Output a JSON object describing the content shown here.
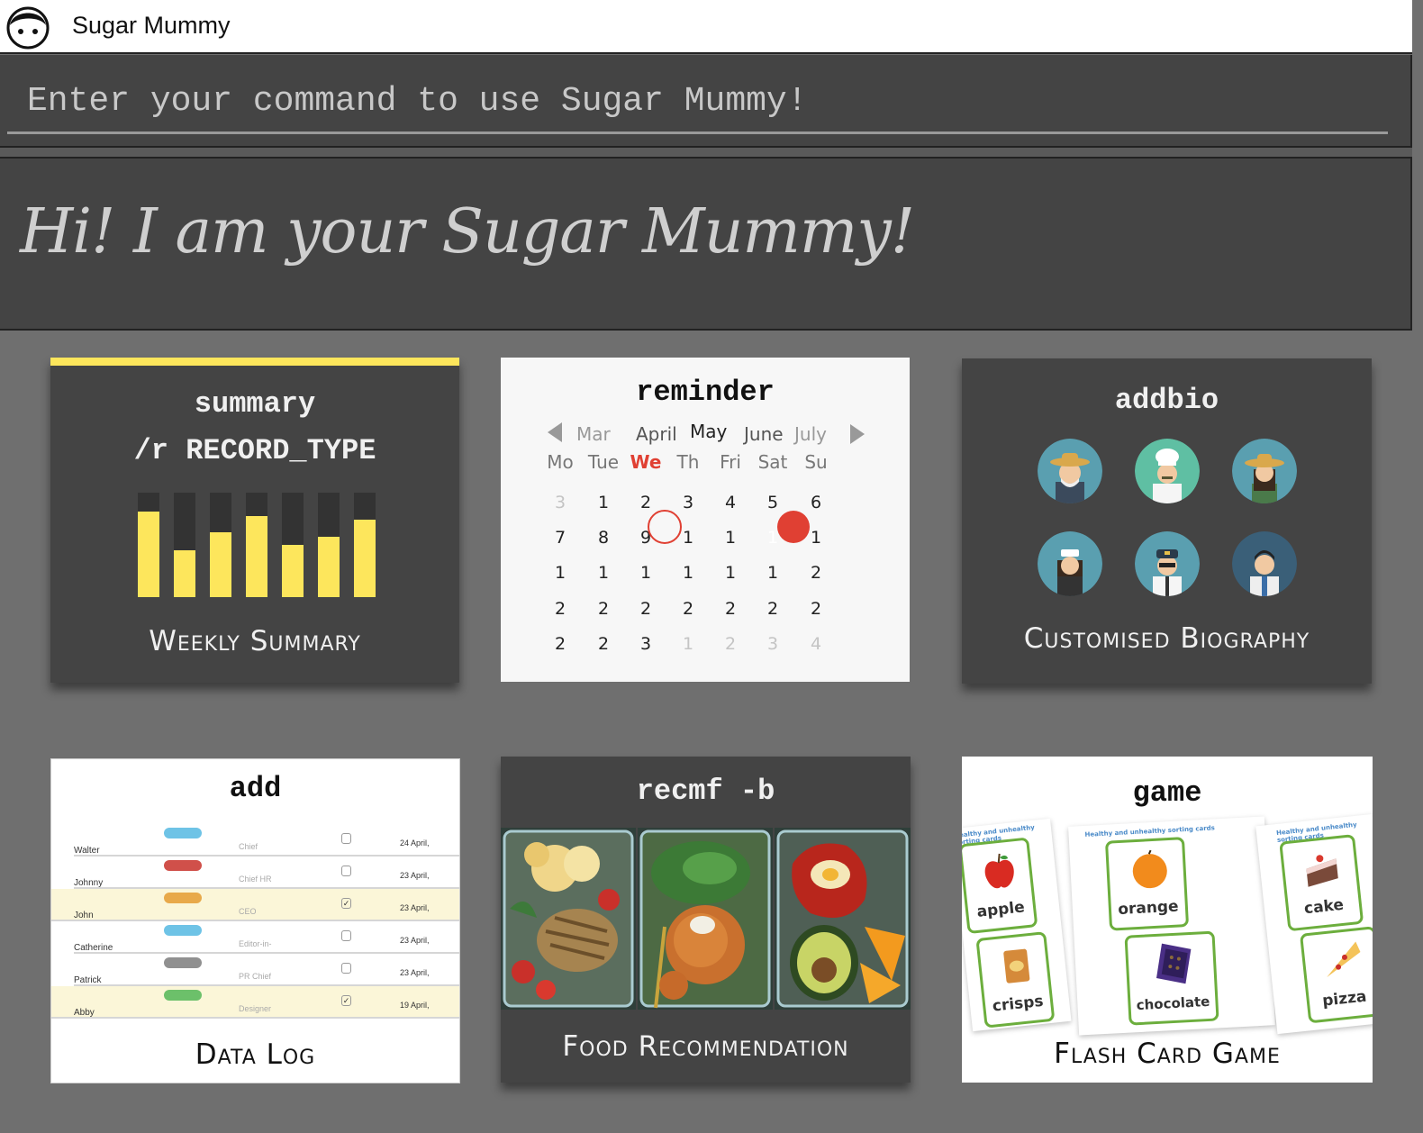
{
  "app": {
    "title": "Sugar Mummy"
  },
  "command": {
    "placeholder": "Enter your command to use Sugar Mummy!"
  },
  "welcome": {
    "greeting": "Hi! I am your Sugar Mummy!"
  },
  "colors": {
    "accent": "#fde65c",
    "panel": "#444444",
    "background": "#6f6f6f",
    "today": "#e04033"
  },
  "cards": {
    "summary": {
      "command_line1": "summary",
      "command_line2": "/r RECORD_TYPE",
      "caption": "Weekly Summary",
      "bar_levels": [
        0.82,
        0.45,
        0.62,
        0.78,
        0.5,
        0.58,
        0.74
      ]
    },
    "reminder": {
      "command": "reminder",
      "months": [
        "Mar",
        "April",
        "May",
        "June",
        "July"
      ],
      "current_month": "May",
      "weekdays": [
        "Mo",
        "Tue",
        "We",
        "Th",
        "Fri",
        "Sat",
        "Su"
      ],
      "today_weekday": "We",
      "weeks": [
        [
          "3",
          "1",
          "2",
          "3",
          "4",
          "5",
          "6"
        ],
        [
          "7",
          "8",
          "9",
          "1",
          "1",
          "1",
          "1"
        ],
        [
          "1",
          "1",
          "1",
          "1",
          "1",
          "1",
          "2"
        ],
        [
          "2",
          "2",
          "2",
          "2",
          "2",
          "2",
          "2"
        ],
        [
          "2",
          "2",
          "3",
          "1",
          "2",
          "3",
          "4"
        ]
      ]
    },
    "addbio": {
      "command": "addbio",
      "caption": "Customised Biography",
      "avatars": [
        "farmer-old-icon",
        "chef-icon",
        "farmer-woman-icon",
        "nurse-icon",
        "pilot-icon",
        "businessman-icon"
      ]
    },
    "add": {
      "command": "add",
      "caption": "Data Log",
      "rows": [
        {
          "name": "Walter",
          "role": "Chief",
          "date": "24 April,",
          "checked": false,
          "tag_color": "#6ec3e6",
          "highlight": false
        },
        {
          "name": "Johnny",
          "role": "Chief HR",
          "date": "23 April,",
          "checked": false,
          "tag_color": "#d0504a",
          "highlight": false
        },
        {
          "name": "John",
          "role": "CEO",
          "date": "23 April,",
          "checked": true,
          "tag_color": "#e8a94a",
          "highlight": true
        },
        {
          "name": "Catherine",
          "role": "Editor-in-",
          "date": "23 April,",
          "checked": false,
          "tag_color": "#6ec3e6",
          "highlight": false
        },
        {
          "name": "Patrick",
          "role": "PR Chief",
          "date": "23 April,",
          "checked": false,
          "tag_color": "#909090",
          "highlight": false
        },
        {
          "name": "Abby",
          "role": "Designer",
          "date": "19 April,",
          "checked": true,
          "tag_color": "#6cc06a",
          "highlight": true
        }
      ]
    },
    "recmf": {
      "command": "recmf -b",
      "caption": "Food Recommendation"
    },
    "game": {
      "command": "game",
      "caption": "Flash Card Game",
      "sheet_title": "Healthy and unhealthy sorting cards",
      "words": [
        "apple",
        "crisps",
        "orange",
        "chocolate",
        "cake",
        "pizza"
      ]
    }
  }
}
